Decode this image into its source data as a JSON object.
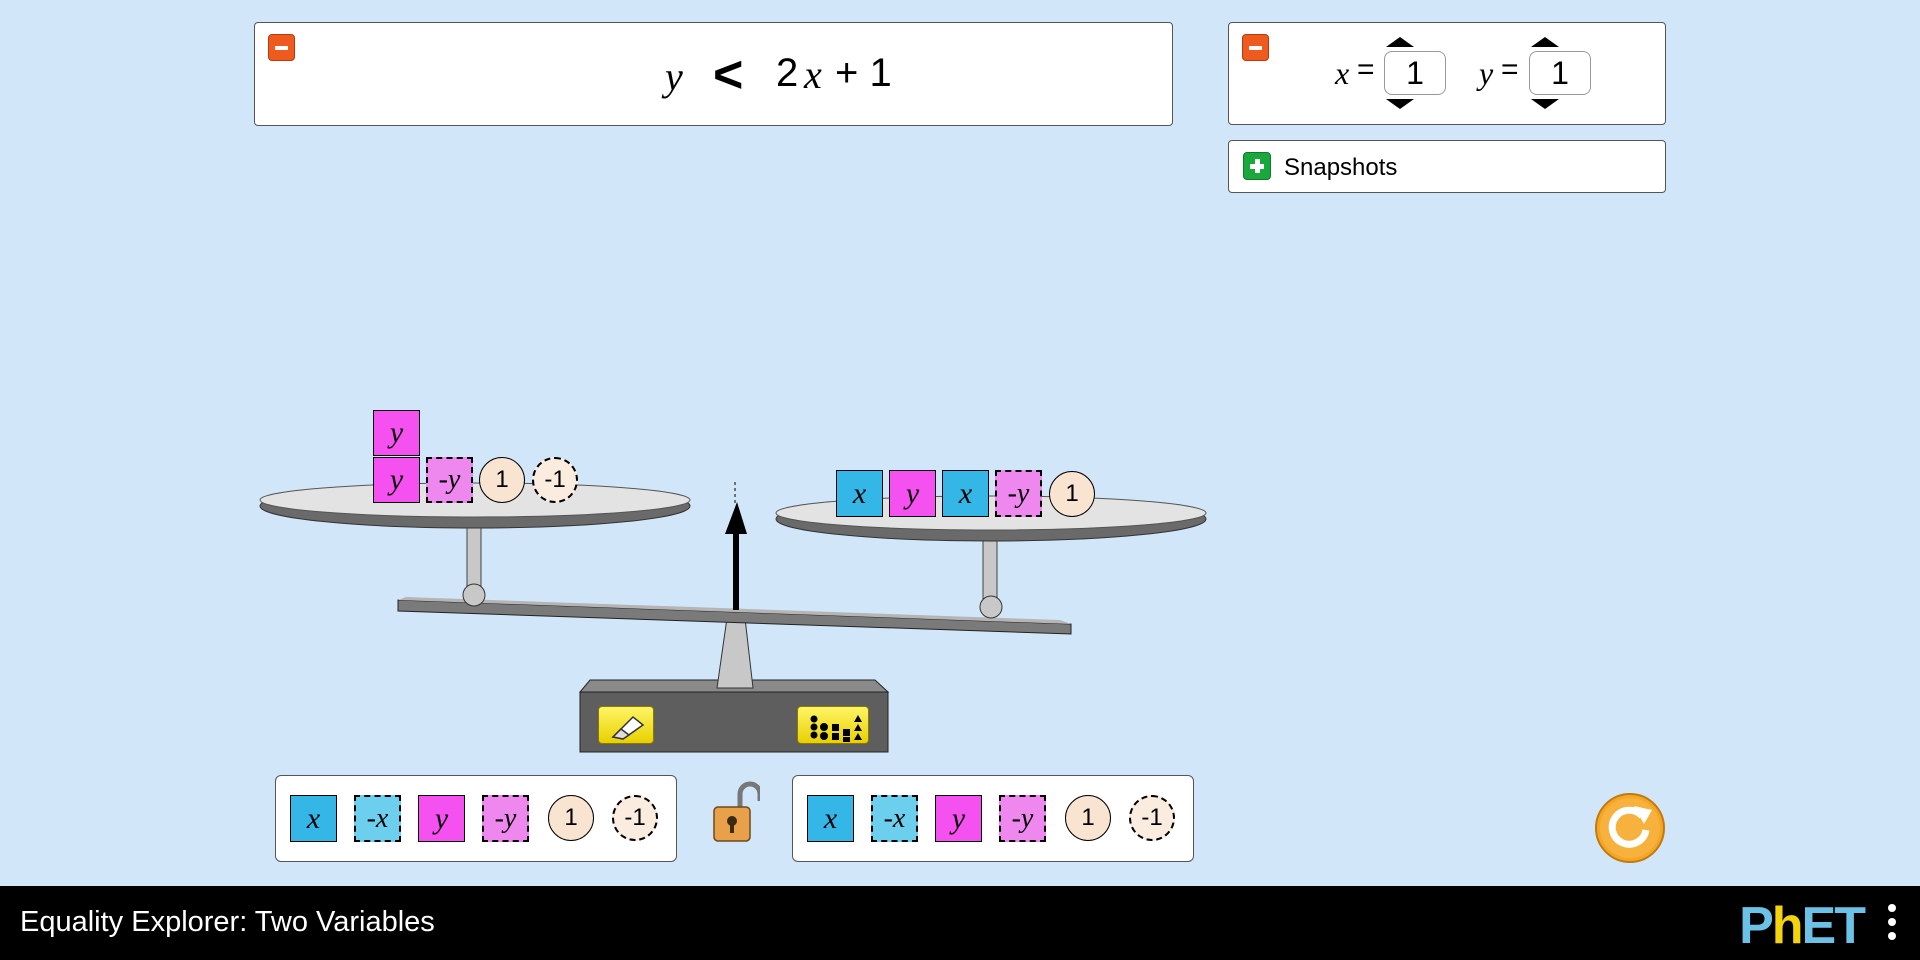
{
  "equation": {
    "lhs": "y",
    "relation": "<",
    "rhs_coef": "2",
    "rhs_var": "x",
    "rhs_rest": "+ 1"
  },
  "variables": {
    "x_label": "x",
    "x_eq": "=",
    "x_value": "1",
    "y_label": "y",
    "y_eq": "=",
    "y_value": "1"
  },
  "snapshots": {
    "label": "Snapshots"
  },
  "left_plate": [
    {
      "kind": "y",
      "label": "y"
    },
    {
      "kind": "y",
      "label": "y"
    },
    {
      "kind": "negy",
      "label": "-y"
    },
    {
      "kind": "one",
      "label": "1"
    },
    {
      "kind": "negone",
      "label": "-1"
    }
  ],
  "right_plate": [
    {
      "kind": "x",
      "label": "x"
    },
    {
      "kind": "y",
      "label": "y"
    },
    {
      "kind": "x",
      "label": "x"
    },
    {
      "kind": "negy",
      "label": "-y"
    },
    {
      "kind": "one",
      "label": "1"
    }
  ],
  "left_toolbox": [
    {
      "kind": "x",
      "label": "x"
    },
    {
      "kind": "negx",
      "label": "-x"
    },
    {
      "kind": "y",
      "label": "y"
    },
    {
      "kind": "negy",
      "label": "-y"
    },
    {
      "kind": "one",
      "label": "1"
    },
    {
      "kind": "negone",
      "label": "-1"
    }
  ],
  "right_toolbox": [
    {
      "kind": "x",
      "label": "x"
    },
    {
      "kind": "negx",
      "label": "-x"
    },
    {
      "kind": "y",
      "label": "y"
    },
    {
      "kind": "negy",
      "label": "-y"
    },
    {
      "kind": "one",
      "label": "1"
    },
    {
      "kind": "negone",
      "label": "-1"
    }
  ],
  "navbar": {
    "title": "Equality Explorer: Two Variables",
    "logo_p": "P",
    "logo_h": "h",
    "logo_et": "ET"
  },
  "colors": {
    "background": "#d2e6fa",
    "x_tile": "#34b6e6",
    "y_tile": "#f550f0",
    "constant_tile": "#f9e4d2",
    "collapse_button": "#ef5a1f",
    "expand_button": "#1aa83c",
    "reset_button": "#f5a623"
  },
  "icons": {
    "collapse": "minus-icon",
    "expand": "plus-icon",
    "clear": "eraser-icon",
    "organize": "organize-icon",
    "lock": "lock-icon",
    "reset": "reset-all-icon",
    "menu": "kebab-menu-icon"
  }
}
